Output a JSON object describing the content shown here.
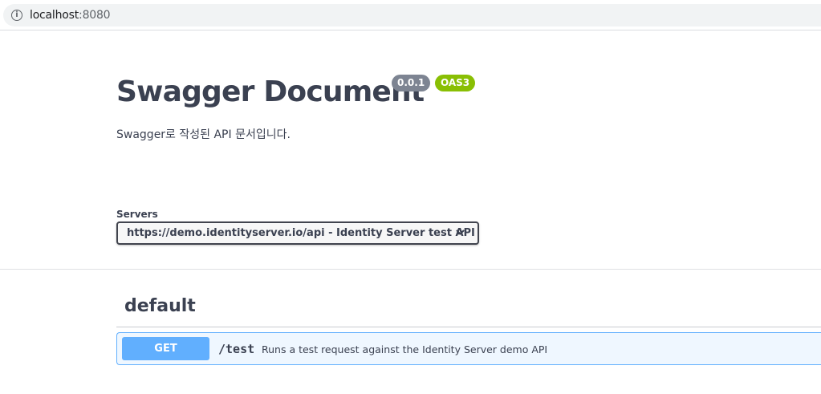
{
  "browser": {
    "url_host": "localhost",
    "url_port": ":8080",
    "info_glyph": "i"
  },
  "info": {
    "title": "Swagger Document",
    "version": "0.0.1",
    "oas_badge": "OAS3",
    "description": "Swagger로 작성된 API 문서입니다."
  },
  "servers": {
    "label": "Servers",
    "selected": "https://demo.identityserver.io/api - Identity Server test API"
  },
  "tag": {
    "name": "default"
  },
  "operation": {
    "method": "GET",
    "path": "/test",
    "summary": "Runs a test request against the Identity Server demo API"
  },
  "colors": {
    "get_method": "#61affe",
    "oas_badge": "#89bf04",
    "version_badge": "#7d8492",
    "text": "#3b4151"
  }
}
